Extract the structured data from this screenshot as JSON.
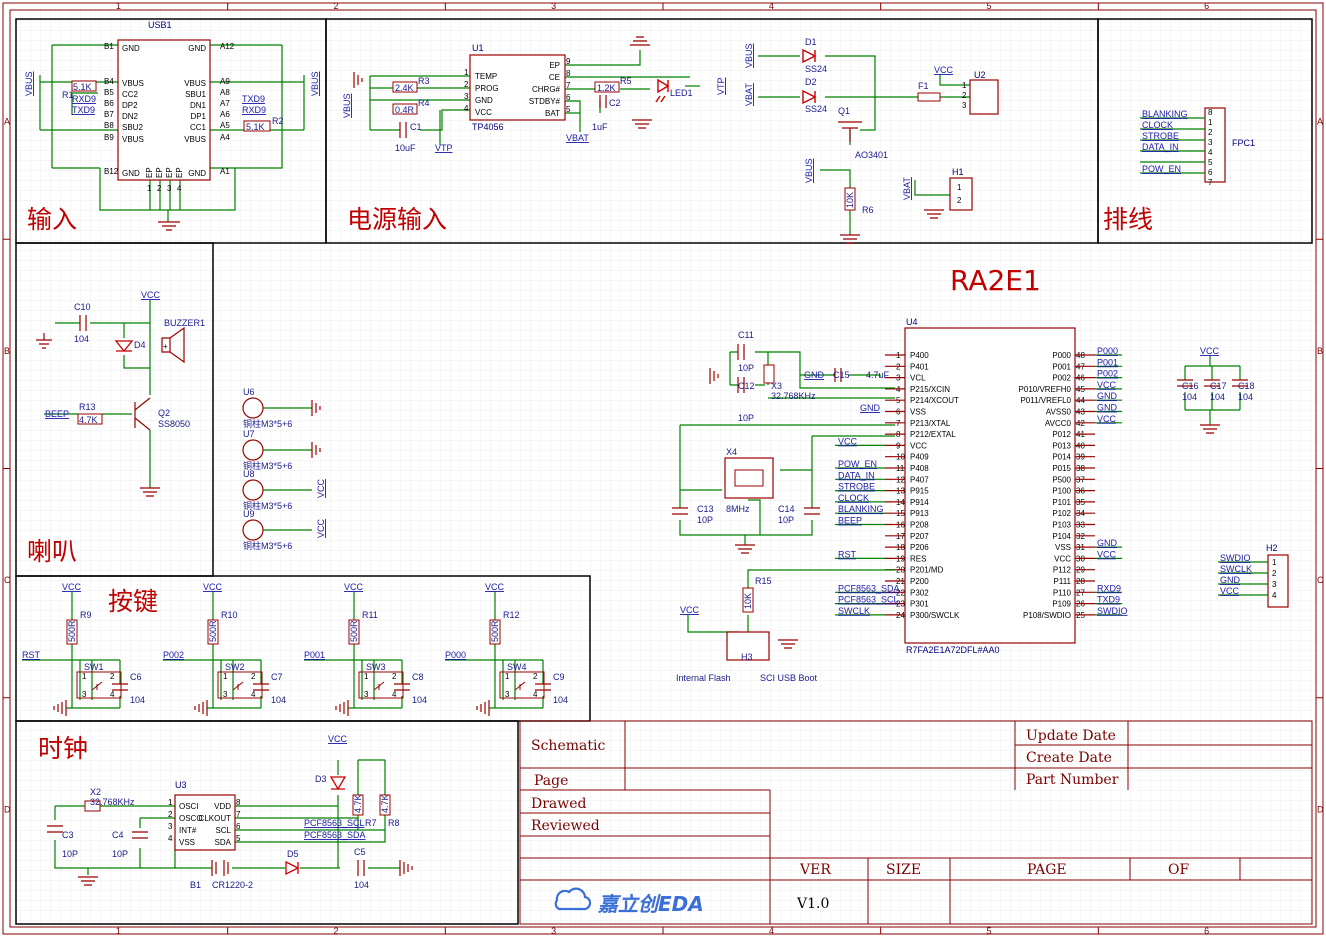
{
  "sections": {
    "input": "输入",
    "power_input": "电源输入",
    "header": "排线",
    "speaker": "喇叭",
    "keys": "按键",
    "clock": "时钟",
    "mcu_title": "RA2E1"
  },
  "ruler": {
    "columns": [
      "1",
      "2",
      "3",
      "4",
      "5",
      "6"
    ],
    "rows": [
      "A",
      "B",
      "C",
      "D"
    ]
  },
  "usb": {
    "ref": "USB1",
    "left_pins": [
      "GND",
      "VBUS",
      "CC2",
      "DP2",
      "DN2",
      "SBU2",
      "VBUS",
      "GND"
    ],
    "right_pins": [
      "GND",
      "VBUS",
      "SBU1",
      "DN1",
      "DP1",
      "CC1",
      "VBUS",
      "GND"
    ],
    "left_nums": [
      "B1",
      "B4",
      "B5",
      "B6",
      "B7",
      "B8",
      "B9",
      "B12"
    ],
    "right_nums": [
      "A12",
      "A9",
      "A8",
      "A7",
      "A6",
      "A5",
      "A4",
      "A1"
    ],
    "bottom_pins": [
      "EP",
      "EP",
      "EP",
      "EP"
    ],
    "bottom_nums": [
      "1",
      "2",
      "3",
      "4"
    ],
    "r1_ref": "R1",
    "r1_val": "5.1K",
    "r2_ref": "R2",
    "r2_val": "5.1K",
    "net_vbus": "VBUS",
    "net_txd9": "TXD9",
    "net_rxd9": "RXD9"
  },
  "power": {
    "u1_ref": "U1",
    "u1_part": "TP4056",
    "u1_left": [
      "TEMP",
      "PROG",
      "GND",
      "VCC"
    ],
    "u1_left_nums": [
      "1",
      "2",
      "3",
      "4"
    ],
    "u1_right": [
      "EP",
      "CE",
      "CHRG#",
      "STDBY#",
      "BAT"
    ],
    "u1_right_nums": [
      "9",
      "8",
      "7",
      "6",
      "5"
    ],
    "r3_ref": "R3",
    "r3_val": "2.4K",
    "r4_ref": "R4",
    "r4_val": "0.4R",
    "r5_ref": "R5",
    "r5_val": "1.2K",
    "c1_ref": "C1",
    "c1_val": "10uF",
    "c2_ref": "C2",
    "c2_val": "1uF",
    "led_ref": "LED1",
    "net_vtp": "VTP",
    "net_vbat": "VBAT",
    "net_vbus": "VBUS",
    "d1_ref": "D1",
    "d1_part": "SS24",
    "d2_ref": "D2",
    "d2_part": "SS24",
    "q1_ref": "Q1",
    "q1_part": "AO3401",
    "f1_ref": "F1",
    "u2_ref": "U2",
    "u2_pins": [
      "1",
      "2",
      "3"
    ],
    "net_vcc": "VCC",
    "r6_ref": "R6",
    "r6_val": "10K",
    "h1_ref": "H1",
    "h1_pins": [
      "1",
      "2"
    ]
  },
  "fpc": {
    "ref": "FPC1",
    "nets": [
      "BLANKING",
      "CLOCK",
      "STROBE",
      "DATA_IN",
      "",
      "POW_EN"
    ],
    "pins": [
      "8",
      "1",
      "2",
      "3",
      "4",
      "5",
      "6",
      "7"
    ]
  },
  "speaker": {
    "c10_ref": "C10",
    "c10_val": "104",
    "d4_ref": "D4",
    "buzzer_ref": "BUZZER1",
    "buzzer_plus": "+",
    "q2_ref": "Q2",
    "q2_part": "SS8050",
    "r13_ref": "R13",
    "r13_val": "4.7K",
    "net_beep": "BEEP",
    "net_vcc": "VCC"
  },
  "standoffs": [
    {
      "ref": "U6",
      "part": "铜柱M3*5+6"
    },
    {
      "ref": "U7",
      "part": "铜柱M3*5+6"
    },
    {
      "ref": "U8",
      "part": "铜柱M3*5+6"
    },
    {
      "ref": "U9",
      "part": "铜柱M3*5+6"
    }
  ],
  "standoff_vcc": "VCC",
  "keys": [
    {
      "net": "RST",
      "r_ref": "R9",
      "r_val": "500R",
      "sw": "SW1",
      "c_ref": "C6",
      "c_val": "104",
      "vcc": "VCC"
    },
    {
      "net": "P002",
      "r_ref": "R10",
      "r_val": "500R",
      "sw": "SW2",
      "c_ref": "C7",
      "c_val": "104",
      "vcc": "VCC"
    },
    {
      "net": "P001",
      "r_ref": "R11",
      "r_val": "500R",
      "sw": "SW3",
      "c_ref": "C8",
      "c_val": "104",
      "vcc": "VCC"
    },
    {
      "net": "P000",
      "r_ref": "R12",
      "r_val": "500R",
      "sw": "SW4",
      "c_ref": "C9",
      "c_val": "104",
      "vcc": "VCC"
    }
  ],
  "sw_pins": [
    "1",
    "2",
    "3",
    "4"
  ],
  "rtc": {
    "u3_ref": "U3",
    "u3_left": [
      "OSCI",
      "OSCO",
      "INT#",
      "VSS"
    ],
    "u3_left_nums": [
      "1",
      "2",
      "3",
      "4"
    ],
    "u3_right": [
      "VDD",
      "CLKOUT",
      "SCL",
      "SDA"
    ],
    "u3_right_nums": [
      "8",
      "7",
      "6",
      "5"
    ],
    "x2_ref": "X2",
    "x2_val": "32.768KHz",
    "c3_ref": "C3",
    "c3_val": "10P",
    "c4_ref": "C4",
    "c4_val": "10P",
    "d3_ref": "D3",
    "d5_ref": "D5",
    "r7_ref": "R7",
    "r7_val": "4.7K",
    "r8_ref": "R8",
    "r8_val": "4.7K",
    "c5_ref": "C5",
    "c5_val": "104",
    "b1_ref": "B1",
    "b1_part": "CR1220-2",
    "net_scl": "PCF8563_SCL",
    "net_sda": "PCF8563_SDA",
    "net_vcc": "VCC"
  },
  "mcu": {
    "ref": "U4",
    "part": "R7FA2E1A72DFL#AA0",
    "left_pins": [
      "P400",
      "P401",
      "VCL",
      "P215/XCIN",
      "P214/XCOUT",
      "VSS",
      "P213/XTAL",
      "P212/EXTAL",
      "VCC",
      "P409",
      "P408",
      "P407",
      "P915",
      "P914",
      "P913",
      "P208",
      "P207",
      "P206",
      "RES",
      "P201/MD",
      "P200",
      "P302",
      "P301",
      "P300/SWCLK"
    ],
    "left_nums": [
      "1",
      "2",
      "3",
      "4",
      "5",
      "6",
      "7",
      "8",
      "9",
      "10",
      "11",
      "12",
      "13",
      "14",
      "15",
      "16",
      "17",
      "18",
      "19",
      "20",
      "21",
      "22",
      "23",
      "24"
    ],
    "right_pins": [
      "P000",
      "P001",
      "P002",
      "P010/VREFH0",
      "P011/VREFL0",
      "AVSS0",
      "AVCC0",
      "P012",
      "P013",
      "P014",
      "P015",
      "P500",
      "P100",
      "P101",
      "P102",
      "P103",
      "P104",
      "VSS",
      "VCC",
      "P112",
      "P111",
      "P110",
      "P109",
      "P108/SWDIO"
    ],
    "right_nums": [
      "48",
      "47",
      "46",
      "45",
      "44",
      "43",
      "42",
      "41",
      "40",
      "39",
      "38",
      "37",
      "36",
      "35",
      "34",
      "33",
      "32",
      "31",
      "30",
      "29",
      "28",
      "27",
      "26",
      "25"
    ],
    "left_nets": {
      "3": "GND",
      "6": "GND",
      "9": "VCC",
      "11": "POW_EN",
      "12": "DATA_IN",
      "13": "STROBE",
      "14": "CLOCK",
      "15": "BLANKING",
      "16": "BEEP",
      "19": "RST",
      "22": "PCF8563_SDA",
      "23": "PCF8563_SCL",
      "24": "SWCLK"
    },
    "right_nets": {
      "48": "P000",
      "47": "P001",
      "46": "P002",
      "45": "VCC",
      "44": "GND",
      "43": "GND",
      "42": "VCC",
      "31": "GND",
      "30": "VCC",
      "27": "RXD9",
      "26": "TXD9",
      "25": "SWDIO"
    },
    "c11_ref": "C11",
    "c11_val": "10P",
    "c12_ref": "C12",
    "c12_val": "10P",
    "x3_ref": "X3",
    "x3_val": "32.768KHz",
    "c15_ref": "C15",
    "c15_val": "4.7uF",
    "x4_ref": "X4",
    "x4_val": "8MHz",
    "c13_ref": "C13",
    "c13_val": "10P",
    "c14_ref": "C14",
    "c14_val": "10P",
    "r15_ref": "R15",
    "r15_val": "10K",
    "h3_ref": "H3",
    "net_vcc": "VCC",
    "net_gnd": "GND",
    "internal_flash": "Internal Flash",
    "sci_boot": "SCI USB Boot",
    "decoupling": [
      {
        "ref": "C16",
        "val": "104"
      },
      {
        "ref": "C17",
        "val": "104"
      },
      {
        "ref": "C18",
        "val": "104"
      }
    ],
    "h2_ref": "H2",
    "h2_nets": [
      "SWDIO",
      "SWCLK",
      "GND",
      "VCC"
    ],
    "h2_pins": [
      "1",
      "2",
      "3",
      "4"
    ]
  },
  "title_block": {
    "schematic": "Schematic",
    "page": "Page",
    "drawed": "Drawed",
    "reviewed": "Reviewed",
    "update_date": "Update Date",
    "create_date": "Create Date",
    "part_number": "Part Number",
    "ver": "VER",
    "size": "SIZE",
    "page_label": "PAGE",
    "of": "OF",
    "version": "V1.0",
    "logo_text": "嘉立创EDA"
  },
  "colors": {
    "wire": "#008000",
    "component": "#990000",
    "net_label": "#1a1aa8",
    "section": "#c00000",
    "frame": "#880000",
    "grid": "#e8e8e8"
  }
}
